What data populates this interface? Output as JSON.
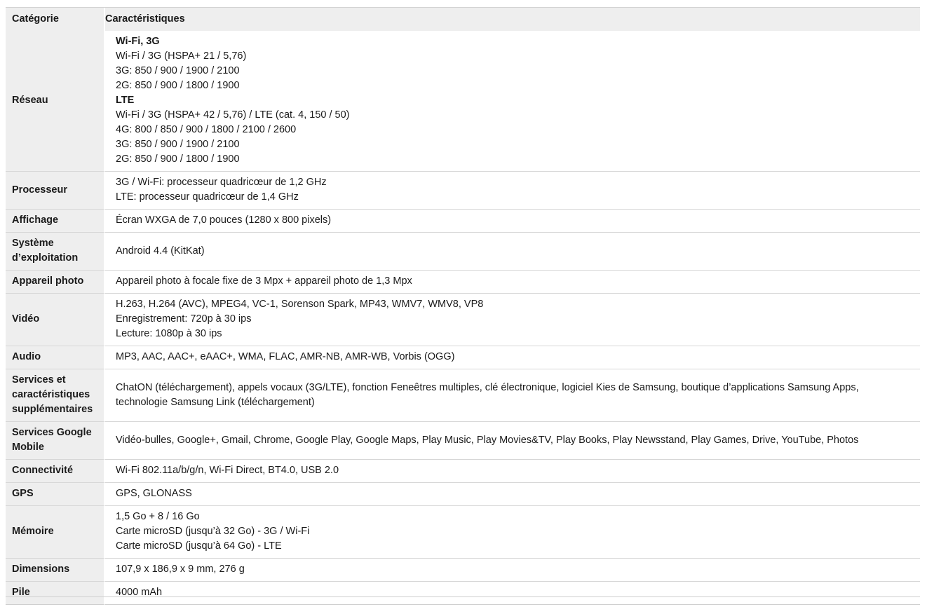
{
  "table": {
    "header": {
      "category": "Catégorie",
      "characteristics": "Caractéristiques"
    },
    "rows": [
      {
        "category": [
          "Réseau"
        ],
        "lines": [
          {
            "text": "Wi-Fi, 3G",
            "bold": true
          },
          {
            "text": "Wi-Fi / 3G (HSPA+ 21 / 5,76)"
          },
          {
            "text": "3G: 850 / 900 / 1900 / 2100"
          },
          {
            "text": "2G: 850 / 900 / 1800 / 1900"
          },
          {
            "text": "LTE",
            "bold": true
          },
          {
            "text": "Wi-Fi / 3G (HSPA+ 42 / 5,76) / LTE (cat. 4, 150 / 50)"
          },
          {
            "text": "4G: 800 / 850 / 900 / 1800 / 2100 / 2600"
          },
          {
            "text": "3G: 850 / 900 / 1900 / 2100"
          },
          {
            "text": "2G: 850 / 900 / 1800 / 1900"
          }
        ]
      },
      {
        "category": [
          "Processeur"
        ],
        "lines": [
          {
            "text": "3G / Wi-Fi: processeur quadricœur de 1,2 GHz"
          },
          {
            "text": "LTE: processeur quadricœur de 1,4 GHz"
          }
        ]
      },
      {
        "category": [
          "Affichage"
        ],
        "lines": [
          {
            "text": "Écran WXGA de 7,0 pouces (1280 x 800 pixels)"
          }
        ]
      },
      {
        "category": [
          "Système",
          "d’exploitation"
        ],
        "lines": [
          {
            "text": "Android 4.4 (KitKat)"
          }
        ]
      },
      {
        "category": [
          "Appareil photo"
        ],
        "lines": [
          {
            "text": "Appareil photo à focale fixe de 3 Mpx + appareil photo de 1,3 Mpx"
          }
        ]
      },
      {
        "category": [
          "Vidéo"
        ],
        "lines": [
          {
            "text": "H.263, H.264 (AVC), MPEG4, VC-1, Sorenson Spark, MP43, WMV7, WMV8, VP8"
          },
          {
            "text": "Enregistrement: 720p à 30 ips"
          },
          {
            "text": "Lecture: 1080p à 30 ips"
          }
        ]
      },
      {
        "category": [
          "Audio"
        ],
        "lines": [
          {
            "text": "MP3, AAC, AAC+, eAAC+, WMA, FLAC, AMR-NB, AMR-WB, Vorbis (OGG)"
          }
        ]
      },
      {
        "category": [
          "Services et",
          "caractéristiques",
          "supplémentaires"
        ],
        "lines": [
          {
            "text": "ChatON (téléchargement), appels vocaux (3G/LTE), fonction Feneêtres multiples, clé électronique, logiciel Kies de Samsung, boutique d’applications Samsung Apps,"
          },
          {
            "text": "technologie Samsung Link (téléchargement)"
          }
        ]
      },
      {
        "category": [
          "Services Google",
          "Mobile"
        ],
        "lines": [
          {
            "text": "Vidéo-bulles, Google+, Gmail, Chrome, Google Play, Google Maps, Play Music, Play Movies&TV, Play Books, Play Newsstand, Play Games, Drive, YouTube, Photos"
          }
        ]
      },
      {
        "category": [
          "Connectivité"
        ],
        "lines": [
          {
            "text": "Wi-Fi 802.11a/b/g/n, Wi-Fi Direct, BT4.0, USB 2.0"
          }
        ]
      },
      {
        "category": [
          "GPS"
        ],
        "lines": [
          {
            "text": "GPS, GLONASS"
          }
        ]
      },
      {
        "category": [
          "Mémoire"
        ],
        "lines": [
          {
            "text": "1,5 Go + 8 / 16 Go"
          },
          {
            "text": "Carte microSD (jusqu’à 32 Go) - 3G / Wi-Fi"
          },
          {
            "text": "Carte microSD (jusqu’à 64 Go) - LTE"
          }
        ]
      },
      {
        "category": [
          "Dimensions"
        ],
        "lines": [
          {
            "text": "107,9 x 186,9 x 9 mm, 276 g"
          }
        ]
      },
      {
        "category": [
          "Pile"
        ],
        "lines": [
          {
            "text": "4000 mAh"
          }
        ]
      }
    ]
  }
}
